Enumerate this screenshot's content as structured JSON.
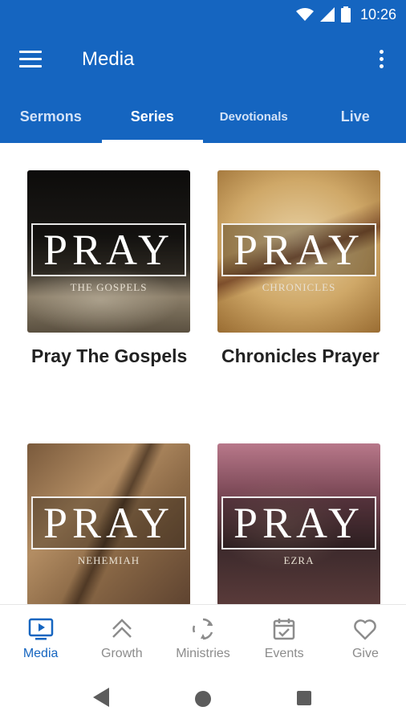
{
  "status_bar": {
    "time": "10:26",
    "icons": [
      "wifi-icon",
      "cell-signal-icon",
      "battery-icon"
    ]
  },
  "app_bar": {
    "title": "Media",
    "menu_icon": "hamburger-menu-icon",
    "overflow_icon": "more-vertical-icon"
  },
  "tabs": [
    {
      "label": "Sermons",
      "active": false
    },
    {
      "label": "Series",
      "active": true
    },
    {
      "label": "Devotionals",
      "active": false
    },
    {
      "label": "Live",
      "active": false
    }
  ],
  "series": [
    {
      "title": "Pray The Gospels",
      "art_word": "PRAY",
      "art_subtitle": "THE GOSPELS"
    },
    {
      "title": "Chronicles Prayer",
      "art_word": "PRAY",
      "art_subtitle": "CHRONICLES"
    },
    {
      "title": "",
      "art_word": "PRAY",
      "art_subtitle": "NEHEMIAH"
    },
    {
      "title": "",
      "art_word": "PRAY",
      "art_subtitle": "EZRA"
    }
  ],
  "bottom_nav": [
    {
      "label": "Media",
      "icon": "media-play-icon",
      "active": true
    },
    {
      "label": "Growth",
      "icon": "chevrons-up-icon",
      "active": false
    },
    {
      "label": "Ministries",
      "icon": "cycle-arrows-icon",
      "active": false
    },
    {
      "label": "Events",
      "icon": "calendar-check-icon",
      "active": false
    },
    {
      "label": "Give",
      "icon": "heart-icon",
      "active": false
    }
  ],
  "colors": {
    "primary": "#1565c0",
    "inactive": "#8c8c8c"
  }
}
